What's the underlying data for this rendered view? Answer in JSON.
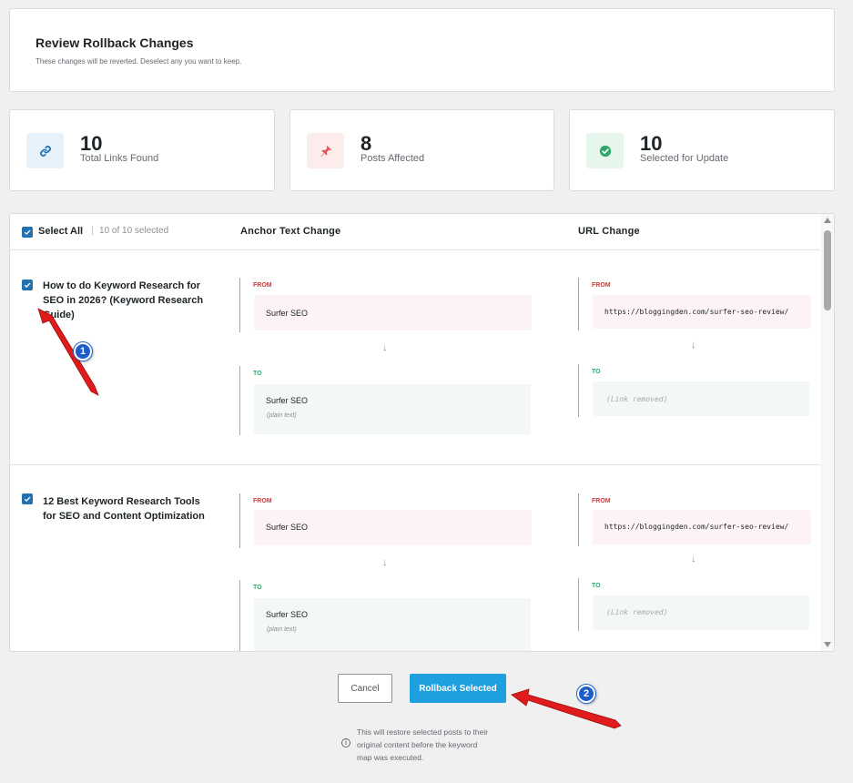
{
  "header": {
    "title": "Review Rollback Changes",
    "subtitle": "These changes will be reverted. Deselect any you want to keep."
  },
  "stats": [
    {
      "value": "10",
      "label": "Total Links Found",
      "icon": "link-icon",
      "color": "#2271b1",
      "bg": "#e7f1fa"
    },
    {
      "value": "8",
      "label": "Posts Affected",
      "icon": "pin-icon",
      "color": "#e65054",
      "bg": "#fdecec"
    },
    {
      "value": "10",
      "label": "Selected for Update",
      "icon": "check-circle-icon",
      "color": "#2ea86a",
      "bg": "#e6f6ec"
    }
  ],
  "table": {
    "select_all_label": "Select All",
    "separator": "|",
    "selected_count": "10 of 10 selected",
    "col_anchor": "Anchor Text Change",
    "col_url": "URL Change",
    "from_label": "FROM",
    "to_label": "TO",
    "arrow": "↓",
    "rows": [
      {
        "title": "How to do Keyword Research for SEO in 2026? (Keyword Research Guide)",
        "anchor_from": "Surfer SEO",
        "anchor_to": "Surfer SEO",
        "anchor_to_note": "(plain text)",
        "url_from": "https://bloggingden.com/surfer-seo-review/",
        "url_to": "(Link removed)",
        "checked": true
      },
      {
        "title": "12 Best Keyword Research Tools for SEO and Content Optimization",
        "anchor_from": "Surfer SEO",
        "anchor_to": "Surfer SEO",
        "anchor_to_note": "(plain text)",
        "url_from": "https://bloggingden.com/surfer-seo-review/",
        "url_to": "(Link removed)",
        "checked": true
      }
    ]
  },
  "footer": {
    "cancel_label": "Cancel",
    "rollback_label": "Rollback Selected",
    "info_icon": "i",
    "info_text": "This will restore selected posts to their original content before the keyword map was executed."
  },
  "annotations": {
    "badge_1": "1",
    "badge_2": "2",
    "arrow_color": "#e01b1b"
  }
}
